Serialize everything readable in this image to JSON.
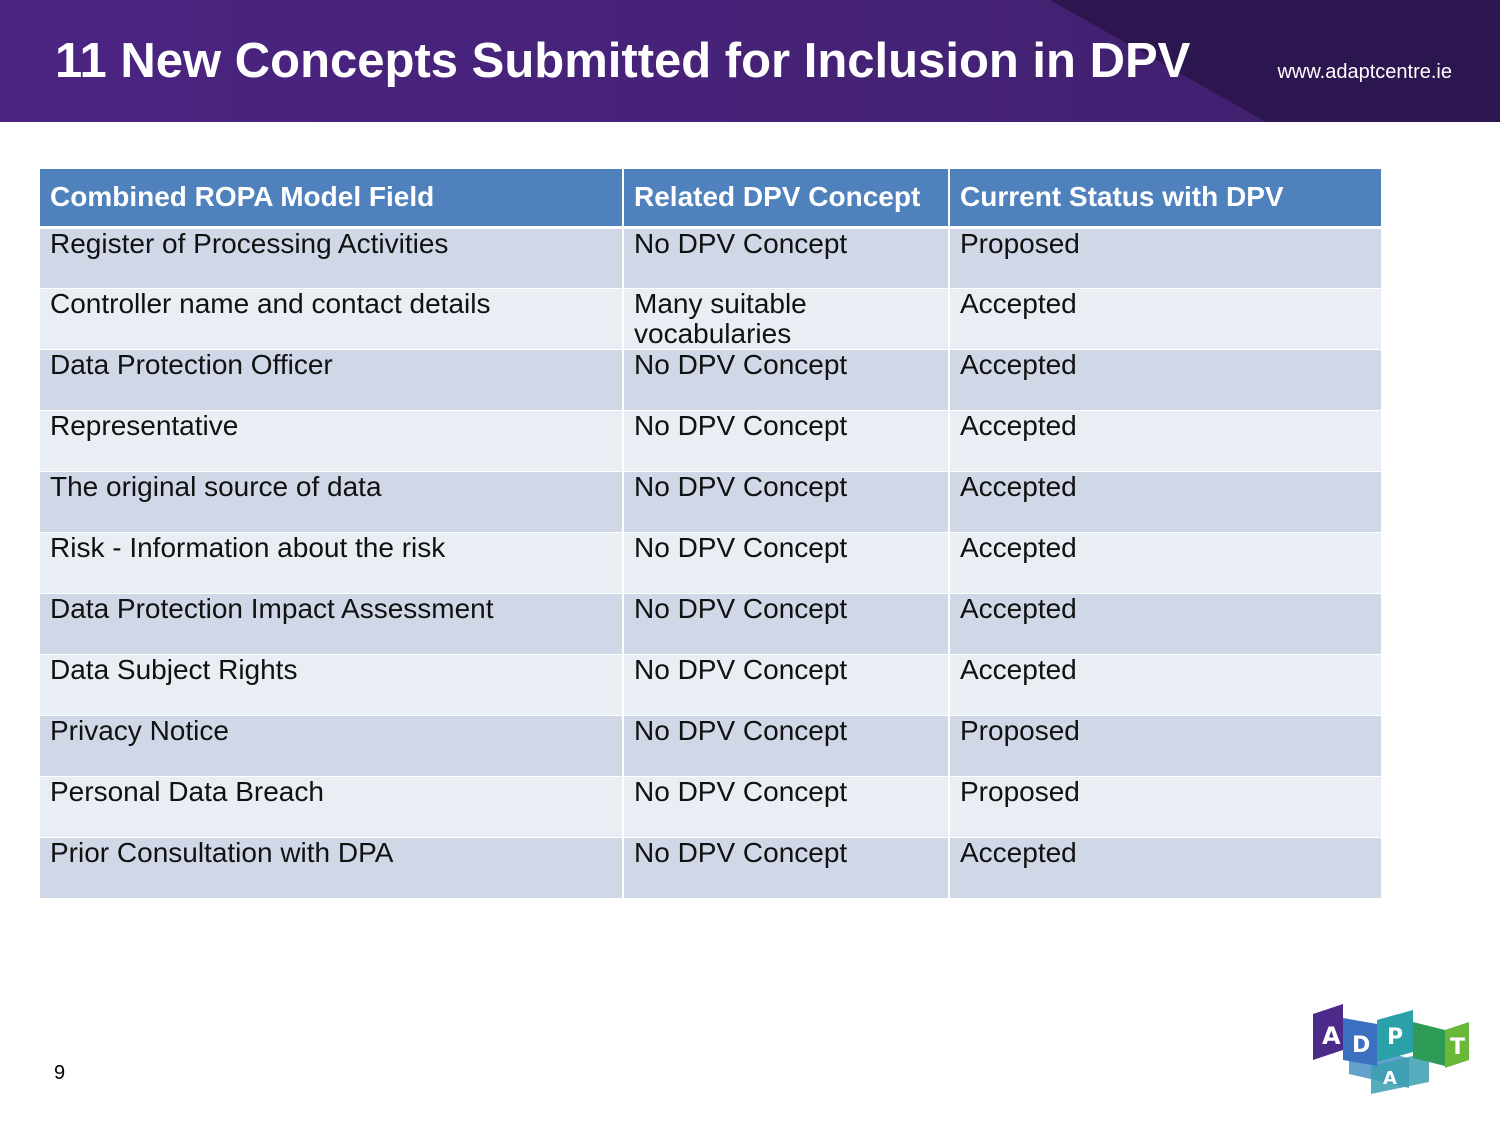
{
  "header": {
    "title": "11 New Concepts Submitted for Inclusion in DPV",
    "url": "www.adaptcentre.ie"
  },
  "table": {
    "columns": [
      "Combined ROPA Model Field",
      "Related DPV Concept",
      "Current Status with DPV"
    ],
    "rows": [
      [
        "Register of Processing Activities",
        "No DPV Concept",
        "Proposed"
      ],
      [
        "Controller name and contact details",
        "Many suitable vocabularies",
        "Accepted"
      ],
      [
        "Data Protection Officer",
        "No DPV Concept",
        "Accepted"
      ],
      [
        "Representative",
        "No DPV Concept",
        "Accepted"
      ],
      [
        "The original source of data",
        "No DPV Concept",
        "Accepted"
      ],
      [
        "Risk - Information about the risk",
        "No DPV Concept",
        "Accepted"
      ],
      [
        "Data Protection Impact Assessment",
        "No DPV Concept",
        "Accepted"
      ],
      [
        "Data Subject Rights",
        "No DPV Concept",
        "Accepted"
      ],
      [
        "Privacy Notice",
        "No DPV Concept",
        "Proposed"
      ],
      [
        "Personal Data Breach",
        "No DPV Concept",
        "Proposed"
      ],
      [
        "Prior Consultation with DPA",
        "No DPV Concept",
        "Accepted"
      ]
    ]
  },
  "footer": {
    "page_number": "9",
    "logo_letters": [
      "A",
      "D",
      "P",
      "A",
      "T"
    ]
  },
  "colors": {
    "header_bg": "#4b2482",
    "table_header": "#4f81bd",
    "row_odd": "#d0d8e8",
    "row_even": "#e9edf4"
  }
}
